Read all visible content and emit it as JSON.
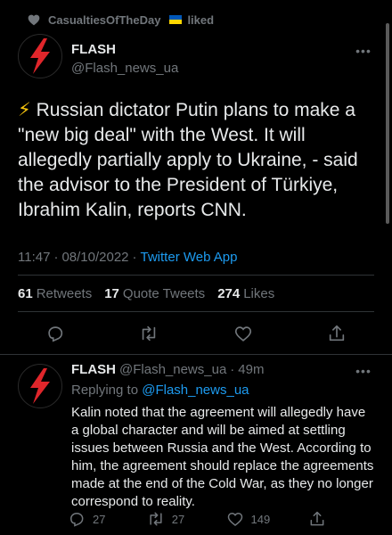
{
  "social_context": {
    "user": "CasualtiesOfTheDay",
    "action": "liked",
    "flag": "ukraine-flag"
  },
  "main_tweet": {
    "name": "FLASH",
    "handle": "@Flash_news_ua",
    "text_icon": "⚡",
    "text_lines": [
      "Russian dictator Putin plans to make a",
      "\"new big deal\" with the West. It will",
      "allegedly partially apply to Ukraine, - said",
      "the advisor to the President of Türkiye,",
      "Ibrahim Kalin, reports CNN."
    ],
    "time": "11:47",
    "date": "08/10/2022",
    "separator": "·",
    "source": "Twitter Web App",
    "stats": {
      "retweets_count": "61",
      "retweets_label": "Retweets",
      "quotes_count": "17",
      "quotes_label": "Quote Tweets",
      "likes_count": "274",
      "likes_label": "Likes"
    }
  },
  "reply_tweet": {
    "name": "FLASH",
    "handle": "@Flash_news_ua",
    "separator": "·",
    "time_ago": "49m",
    "replying_prefix": "Replying to",
    "replying_to": "@Flash_news_ua",
    "text_lines": [
      "Kalin noted that the agreement will allegedly have",
      "a global character and will be aimed at settling",
      "issues between Russia and the West. According to",
      "him, the agreement should replace the agreements",
      "made at the end of the Cold War, as they no longer",
      "correspond to reality."
    ],
    "reply_count": "27",
    "retweet_count": "27",
    "like_count": "149"
  },
  "more_glyph": "•••",
  "colors": {
    "background": "#000000",
    "text": "#e7e9ea",
    "muted": "#71767b",
    "accent": "#1d9bf0",
    "avatar_bolt": "#e0262b"
  }
}
